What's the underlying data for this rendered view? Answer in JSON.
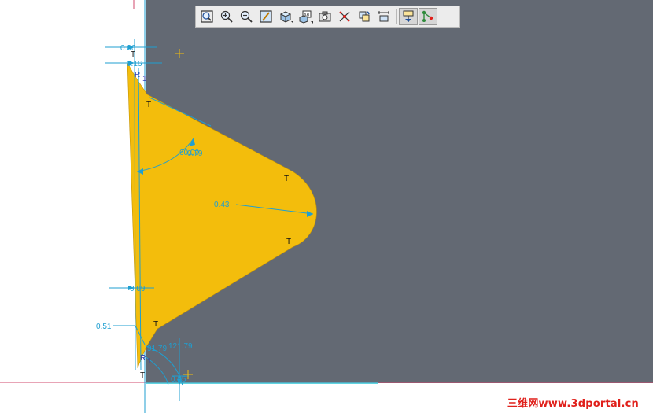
{
  "colors": {
    "canvas_left": "#ffffff",
    "canvas_right": "#636973",
    "part_fill": "#f3bd0c",
    "dimension": "#1f9fd1",
    "constraint_text": "#111111",
    "axis_line": "#d2486e",
    "watermark": "#e0201b"
  },
  "toolbar": {
    "buttons": [
      {
        "icon": "zoom-fit-icon"
      },
      {
        "icon": "zoom-in-icon"
      },
      {
        "icon": "zoom-out-icon"
      },
      {
        "icon": "repaint-icon"
      },
      {
        "icon": "view-orientation-icon",
        "dropdown": true
      },
      {
        "icon": "display-style-icon",
        "dropdown": true
      },
      {
        "icon": "saved-views-icon"
      },
      {
        "icon": "datum-display-icon"
      },
      {
        "icon": "spin-center-icon"
      },
      {
        "icon": "annotation-display-icon"
      },
      {
        "icon": "sketch-view-icon",
        "active": true
      },
      {
        "icon": "sketch-display-icon",
        "active": true
      }
    ]
  },
  "sketch": {
    "dimensions": {
      "top_width": "0.06",
      "top_offset": "0.16",
      "angle_upper_a": "60.00",
      "angle_upper_b": "0.79",
      "nose_radius": "0.43",
      "bottom_width": "0.09",
      "left_width": "0.51",
      "angle_lower_a": "91.79",
      "angle_lower_b": "121.79",
      "bottom_offset": "0.05"
    },
    "constraints": {
      "tangent": "T",
      "radius": "R",
      "equal_index": "1"
    }
  },
  "watermark": {
    "text": "三维网www.3dportal.cn"
  }
}
